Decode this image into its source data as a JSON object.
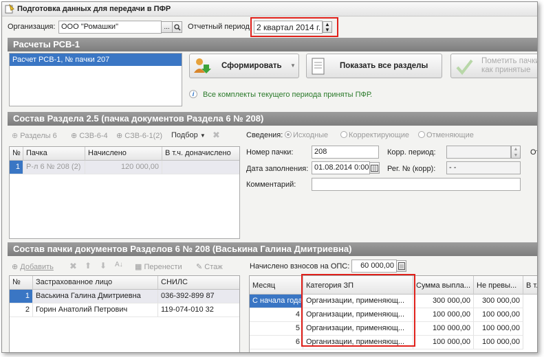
{
  "window": {
    "title": "Подготовка данных для передачи в ПФР"
  },
  "org": {
    "label": "Организация:",
    "value": "ООО \"Ромашки\"",
    "dots": "..."
  },
  "period": {
    "label": "Отчетный период:",
    "value": "2 квартал 2014 г."
  },
  "rsv": {
    "header": "Расчеты РСВ-1",
    "items": [
      "Расчет РСВ-1, № пачки 207"
    ],
    "form_button": "Сформировать",
    "show_button": "Показать все разделы",
    "mark_button": "Пометить пачки как принятые",
    "info": "Все комплекты текущего периода приняты ПФР."
  },
  "section25": {
    "header": "Состав Раздела 2.5     (пачка документов Раздела 6 № 208)",
    "toolbar": {
      "razdely": "Разделы 6",
      "szv64": "СЗВ-6-4",
      "szv61": "СЗВ-6-1(2)",
      "podbor": "Подбор"
    },
    "columns": [
      "№",
      "Пачка",
      "Начислено",
      "В т.ч. доначислено"
    ],
    "rows": [
      {
        "n": "1",
        "pachka": "Р-л 6 № 208 (2)",
        "nachisleno": "120 000,00",
        "donach": ""
      }
    ],
    "svedenia_label": "Сведения:",
    "radios": [
      "Исходные",
      "Корректирующие",
      "Отменяющие"
    ],
    "nomer_label": "Номер пачки:",
    "nomer": "208",
    "korr_label": "Корр. период:",
    "korr": "",
    "date_label": "Дата заполнения:",
    "date": "01.08.2014  0:00",
    "reg_label": "Рег. № (корр):",
    "reg": "-  -",
    "comment_label": "Комментарий:",
    "comment": "",
    "cut_label": "От"
  },
  "pack": {
    "header": "Состав пачки документов Разделов 6 № 208        (Васькина Галина Дмитриевна)",
    "toolbar": {
      "add": "Добавить",
      "move": "Перенести",
      "stazh": "Стаж"
    },
    "columns": [
      "№",
      "Застрахованное лицо",
      "СНИЛС"
    ],
    "rows": [
      {
        "n": "1",
        "name": "Васькина Галина Дмитриевна",
        "snils": "036-392-899 87"
      },
      {
        "n": "2",
        "name": "Горин Анатолий Петрович",
        "snils": "119-074-010 32"
      }
    ],
    "ops_label": "Начислено взносов на ОПС:",
    "ops": "60 000,00",
    "grid_columns": [
      "Месяц",
      "Категория ЗП",
      "Сумма выпла...",
      "Не превы...",
      "В т."
    ],
    "grid_rows": [
      {
        "month": "С начала года",
        "cat": "Организации, применяющ...",
        "sum": "300 000,00",
        "np": "300 000,00"
      },
      {
        "month": "4",
        "cat": "Организации, применяющ...",
        "sum": "100 000,00",
        "np": "100 000,00"
      },
      {
        "month": "5",
        "cat": "Организации, применяющ...",
        "sum": "100 000,00",
        "np": "100 000,00"
      },
      {
        "month": "6",
        "cat": "Организации, применяющ...",
        "sum": "100 000,00",
        "np": "100 000,00"
      }
    ]
  },
  "colors": {
    "highlight": "#e0201a",
    "section": "#8a8a8a",
    "selected": "#3a76c4"
  }
}
